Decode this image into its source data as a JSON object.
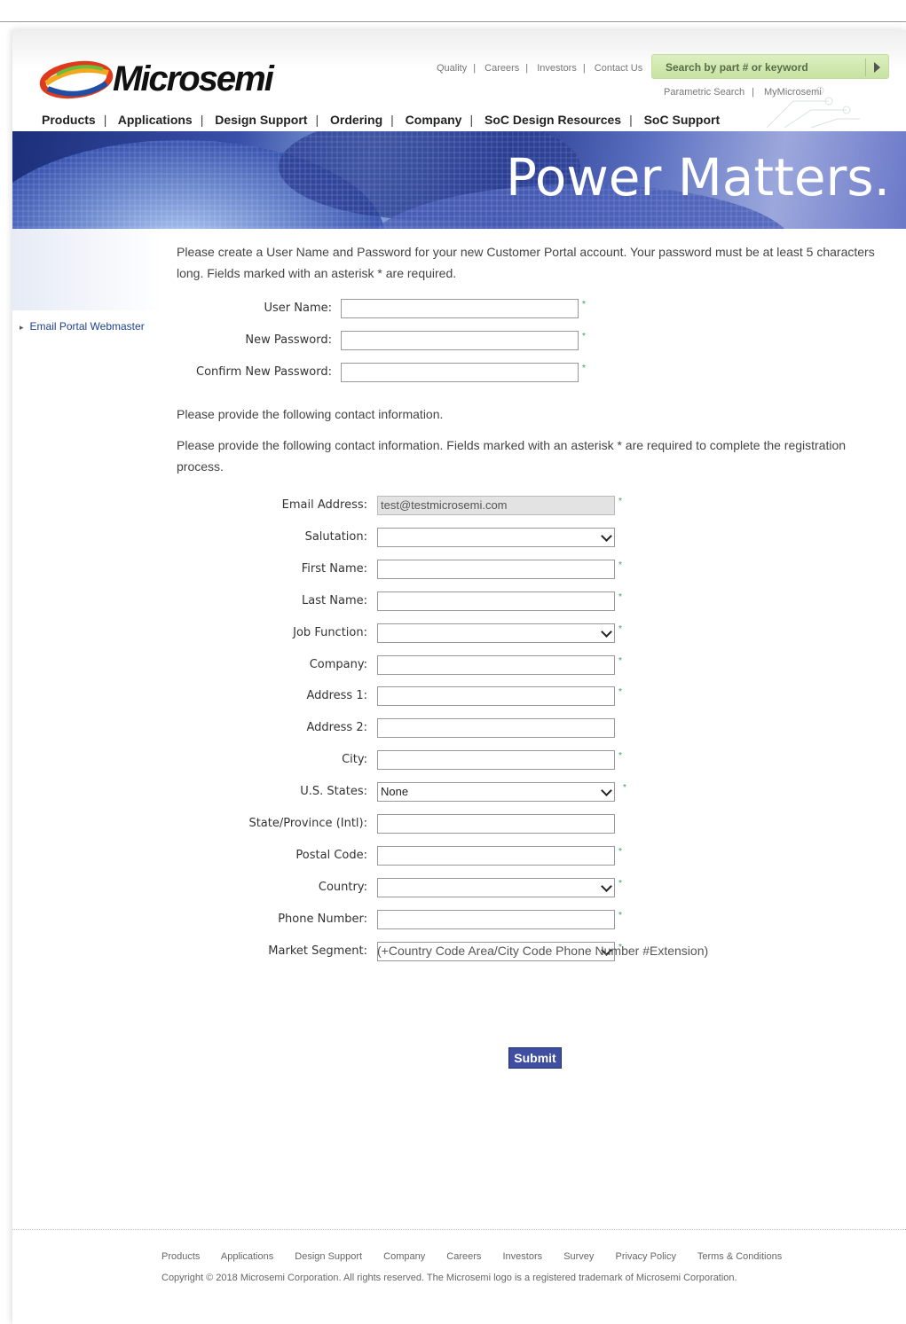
{
  "header": {
    "logo_text": "Microsemi",
    "top_links": [
      "Quality",
      "Careers",
      "Investors",
      "Contact Us"
    ],
    "search_placeholder": "Search by part # or keyword",
    "sub_links": [
      "Parametric Search",
      "MyMicrosemi"
    ],
    "nav": [
      "Products",
      "Applications",
      "Design Support",
      "Ordering",
      "Company",
      "SoC Design Resources",
      "SoC Support"
    ]
  },
  "banner": {
    "tagline": "Power Matters."
  },
  "sidebar": {
    "link": "Email Portal Webmaster"
  },
  "intro": {
    "account_text": "Please create a User Name and Password for your new Customer Portal account. Your password must be at least 5 characters long. Fields marked with an asterisk * are required.",
    "contact_text_1": "Please provide the following contact information.",
    "contact_text_2": "Please provide the following contact information. Fields marked with an asterisk * are required to complete the registration process."
  },
  "account_fields": [
    {
      "label": "User Name:",
      "value": "",
      "required": true
    },
    {
      "label": "New Password:",
      "value": "",
      "required": true
    },
    {
      "label": "Confirm New Password:",
      "value": "",
      "required": true
    }
  ],
  "contact_fields": [
    {
      "label": "Email Address:",
      "value": "test@testmicrosemi.com",
      "type": "text",
      "required": true,
      "disabled": true
    },
    {
      "label": "Salutation:",
      "value": "",
      "type": "select",
      "required": false
    },
    {
      "label": "First Name:",
      "value": "",
      "type": "text",
      "required": true
    },
    {
      "label": "Last Name:",
      "value": "",
      "type": "text",
      "required": true
    },
    {
      "label": "Job Function:",
      "value": "",
      "type": "select",
      "required": true
    },
    {
      "label": "Company:",
      "value": "",
      "type": "text",
      "required": true
    },
    {
      "label": "Address 1:",
      "value": "",
      "type": "text",
      "required": true
    },
    {
      "label": "Address 2:",
      "value": "",
      "type": "text",
      "required": false
    },
    {
      "label": "City:",
      "value": "",
      "type": "text",
      "required": true
    },
    {
      "label": "U.S. States:",
      "value": "None",
      "type": "select",
      "required": true
    },
    {
      "label": "State/Province (Intl):",
      "value": "",
      "type": "text",
      "required": false
    },
    {
      "label": "Postal Code:",
      "value": "",
      "type": "text",
      "required": true
    },
    {
      "label": "Country:",
      "value": "",
      "type": "select",
      "required": true
    },
    {
      "label": "Phone Number:",
      "value": "",
      "type": "text",
      "required": true
    },
    {
      "label": "Market Segment:",
      "value": "",
      "type": "select",
      "required": true
    }
  ],
  "phone_hint": "(+Country Code Area/City Code Phone Number #Extension)",
  "submit_label": "Submit",
  "asterisk": "*",
  "footer": {
    "links": [
      "Products",
      "Applications",
      "Design Support",
      "Company",
      "Careers",
      "Investors",
      "Survey",
      "Privacy Policy",
      "Terms & Conditions"
    ],
    "copyright": "Copyright © 2018 Microsemi Corporation. All rights reserved. The Microsemi logo is a registered trademark of Microsemi Corporation."
  },
  "colors": {
    "accent": "#3f4ea0",
    "required": "#2aa84a",
    "search_bg": "#c7e3a2",
    "link": "#1f3f8f"
  }
}
